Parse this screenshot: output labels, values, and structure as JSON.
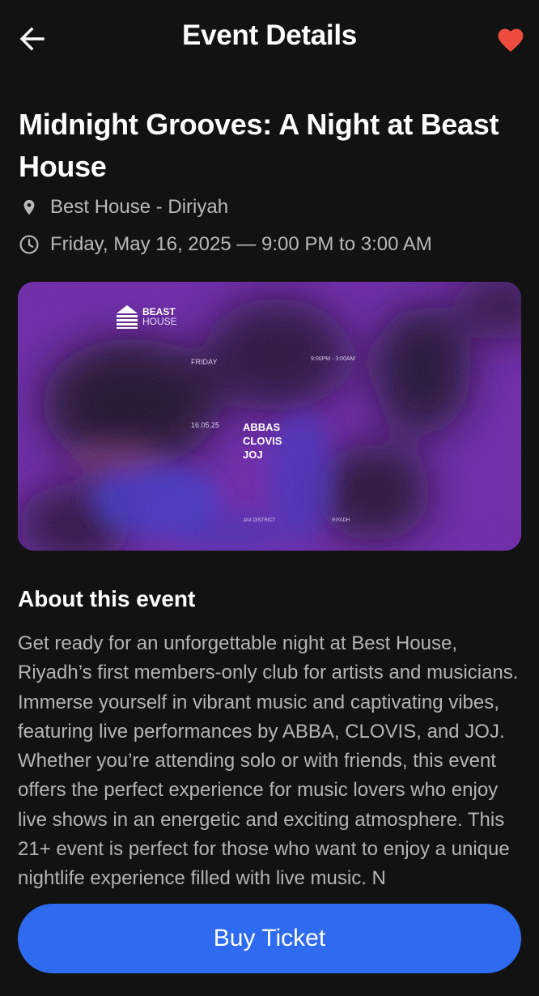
{
  "header": {
    "title": "Event Details",
    "back_icon": "arrow-left-icon",
    "favorite_icon": "heart-icon",
    "favorite_color": "#ec4b3e"
  },
  "event": {
    "title": "Midnight Grooves: A Night at Beast House",
    "location": "Best House - Diriyah",
    "datetime": "Friday, May 16, 2025 — 9:00 PM to 3:00 AM",
    "location_icon": "map-pin-icon",
    "time_icon": "clock-icon"
  },
  "poster": {
    "logo_word1": "BEAST",
    "logo_word2": "HOUSE",
    "day": "FRIDAY",
    "time": "9:00PM - 3:00AM",
    "date": "16.05.25",
    "artists": [
      "ABBAS",
      "CLOVIS",
      "JOJ"
    ],
    "district": "JAX DISTRICT",
    "city": "RIYADH"
  },
  "about": {
    "title": "About this event",
    "body": "Get ready for an unforgettable night at Best House, Riyadh’s first members-only club for artists and musicians. Immerse yourself in vibrant music and captivating vibes, featuring live performances by ABBA, CLOVIS, and JOJ. Whether you’re attending solo or with friends, this event offers the perfect experience for music lovers who enjoy live shows in an energetic and exciting atmosphere. This 21+ event is perfect for those who want to enjoy a unique nightlife experience filled with live music. N"
  },
  "actions": {
    "buy_label": "Buy Ticket",
    "accent_color": "#2f6bf1"
  }
}
